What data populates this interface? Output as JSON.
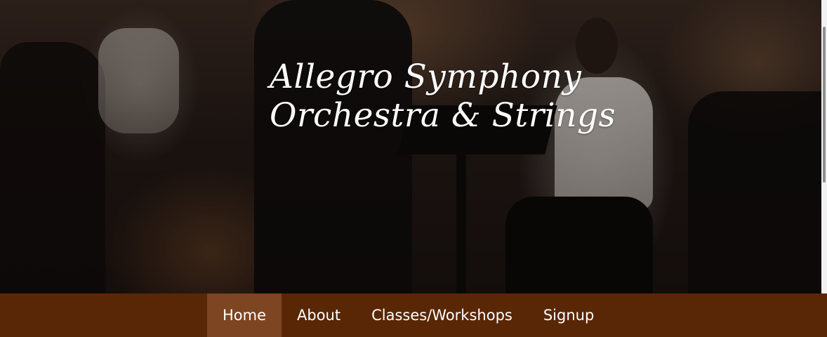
{
  "hero": {
    "title_line1": "Allegro Symphony",
    "title_line2": "Orchestra & Strings"
  },
  "nav": {
    "items": [
      {
        "label": "Home",
        "active": true
      },
      {
        "label": "About",
        "active": false
      },
      {
        "label": "Classes/Workshops",
        "active": false
      },
      {
        "label": "Signup",
        "active": false
      }
    ]
  },
  "colors": {
    "nav_background": "#5a2706",
    "nav_active": "#7d4521",
    "title_text": "#ffffff"
  }
}
